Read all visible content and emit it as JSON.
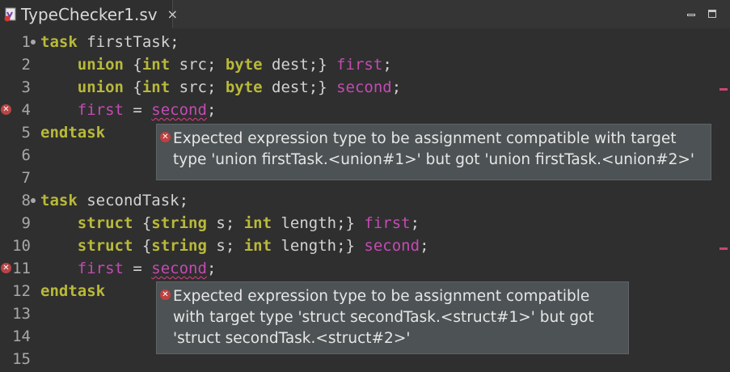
{
  "tab": {
    "title": "TypeChecker1.sv",
    "close": "×"
  },
  "editor": {
    "lines": [
      {
        "n": "1",
        "fold": true,
        "tokens": [
          [
            "kw",
            "task"
          ],
          [
            "p",
            " firstTask;"
          ]
        ]
      },
      {
        "n": "2",
        "tokens": [
          [
            "p",
            "    "
          ],
          [
            "kw",
            "union"
          ],
          [
            "p",
            " {"
          ],
          [
            "kw",
            "int"
          ],
          [
            "p",
            " src; "
          ],
          [
            "kw",
            "byte"
          ],
          [
            "p",
            " dest;} "
          ],
          [
            "id",
            "first"
          ],
          [
            "p",
            ";"
          ]
        ]
      },
      {
        "n": "3",
        "tokens": [
          [
            "p",
            "    "
          ],
          [
            "kw",
            "union"
          ],
          [
            "p",
            " {"
          ],
          [
            "kw",
            "int"
          ],
          [
            "p",
            " src; "
          ],
          [
            "kw",
            "byte"
          ],
          [
            "p",
            " dest;} "
          ],
          [
            "id",
            "second"
          ],
          [
            "p",
            ";"
          ]
        ]
      },
      {
        "n": "4",
        "error": true,
        "tokens": [
          [
            "p",
            "    "
          ],
          [
            "id",
            "first"
          ],
          [
            "p",
            " = "
          ],
          [
            "iderr",
            "second"
          ],
          [
            "p",
            ";"
          ]
        ]
      },
      {
        "n": "5",
        "tokens": [
          [
            "kw",
            "endtask"
          ]
        ]
      },
      {
        "n": "6",
        "tokens": []
      },
      {
        "n": "7",
        "tokens": []
      },
      {
        "n": "8",
        "fold": true,
        "tokens": [
          [
            "kw",
            "task"
          ],
          [
            "p",
            " secondTask;"
          ]
        ]
      },
      {
        "n": "9",
        "tokens": [
          [
            "p",
            "    "
          ],
          [
            "kw",
            "struct"
          ],
          [
            "p",
            " {"
          ],
          [
            "kw",
            "string"
          ],
          [
            "p",
            " s; "
          ],
          [
            "kw",
            "int"
          ],
          [
            "p",
            " length;} "
          ],
          [
            "id",
            "first"
          ],
          [
            "p",
            ";"
          ]
        ]
      },
      {
        "n": "10",
        "tokens": [
          [
            "p",
            "    "
          ],
          [
            "kw",
            "struct"
          ],
          [
            "p",
            " {"
          ],
          [
            "kw",
            "string"
          ],
          [
            "p",
            " s; "
          ],
          [
            "kw",
            "int"
          ],
          [
            "p",
            " length;} "
          ],
          [
            "id",
            "second"
          ],
          [
            "p",
            ";"
          ]
        ]
      },
      {
        "n": "11",
        "error": true,
        "tokens": [
          [
            "p",
            "    "
          ],
          [
            "id",
            "first"
          ],
          [
            "p",
            " = "
          ],
          [
            "iderr",
            "second"
          ],
          [
            "p",
            ";"
          ]
        ]
      },
      {
        "n": "12",
        "tokens": [
          [
            "kw",
            "endtask"
          ]
        ]
      },
      {
        "n": "13",
        "tokens": []
      },
      {
        "n": "14",
        "tokens": []
      },
      {
        "n": "15",
        "tokens": []
      }
    ]
  },
  "hovers": [
    {
      "lines": [
        "Expected expression type to be assignment compatible with target",
        "type 'union firstTask.<union#1>' but got 'union firstTask.<union#2>'"
      ]
    },
    {
      "lines": [
        "Expected expression type to be assignment compatible",
        "with target type 'struct secondTask.<struct#1>' but got",
        "'struct secondTask.<struct#2>'"
      ]
    }
  ],
  "colors": {
    "keyword": "#b9b93a",
    "identifier": "#c34bb3",
    "error": "#b84545",
    "background": "#2f2f2f"
  },
  "icons": {
    "file": "sv-file-icon",
    "error": "error-icon",
    "fold": "fold-icon"
  }
}
